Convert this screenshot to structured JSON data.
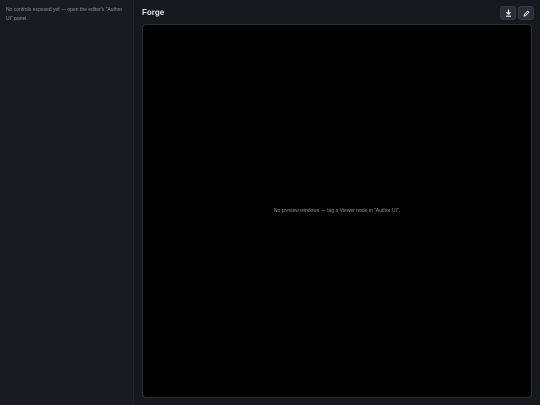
{
  "sidebar": {
    "message": "No controls exposed yet — open the editor's \"Author UI\" panel."
  },
  "header": {
    "title": "Forge",
    "download_icon": "download-icon",
    "edit_icon": "pencil-icon"
  },
  "preview": {
    "empty_message": "No preview windows — tag a Viewer node in \"Author UI\"."
  },
  "colors": {
    "background": "#15181c",
    "sidebar": "#181b1f",
    "preview": "#000000",
    "button": "#2a2f35",
    "text": "#e6e8eb",
    "muted_text": "#8b929b"
  }
}
